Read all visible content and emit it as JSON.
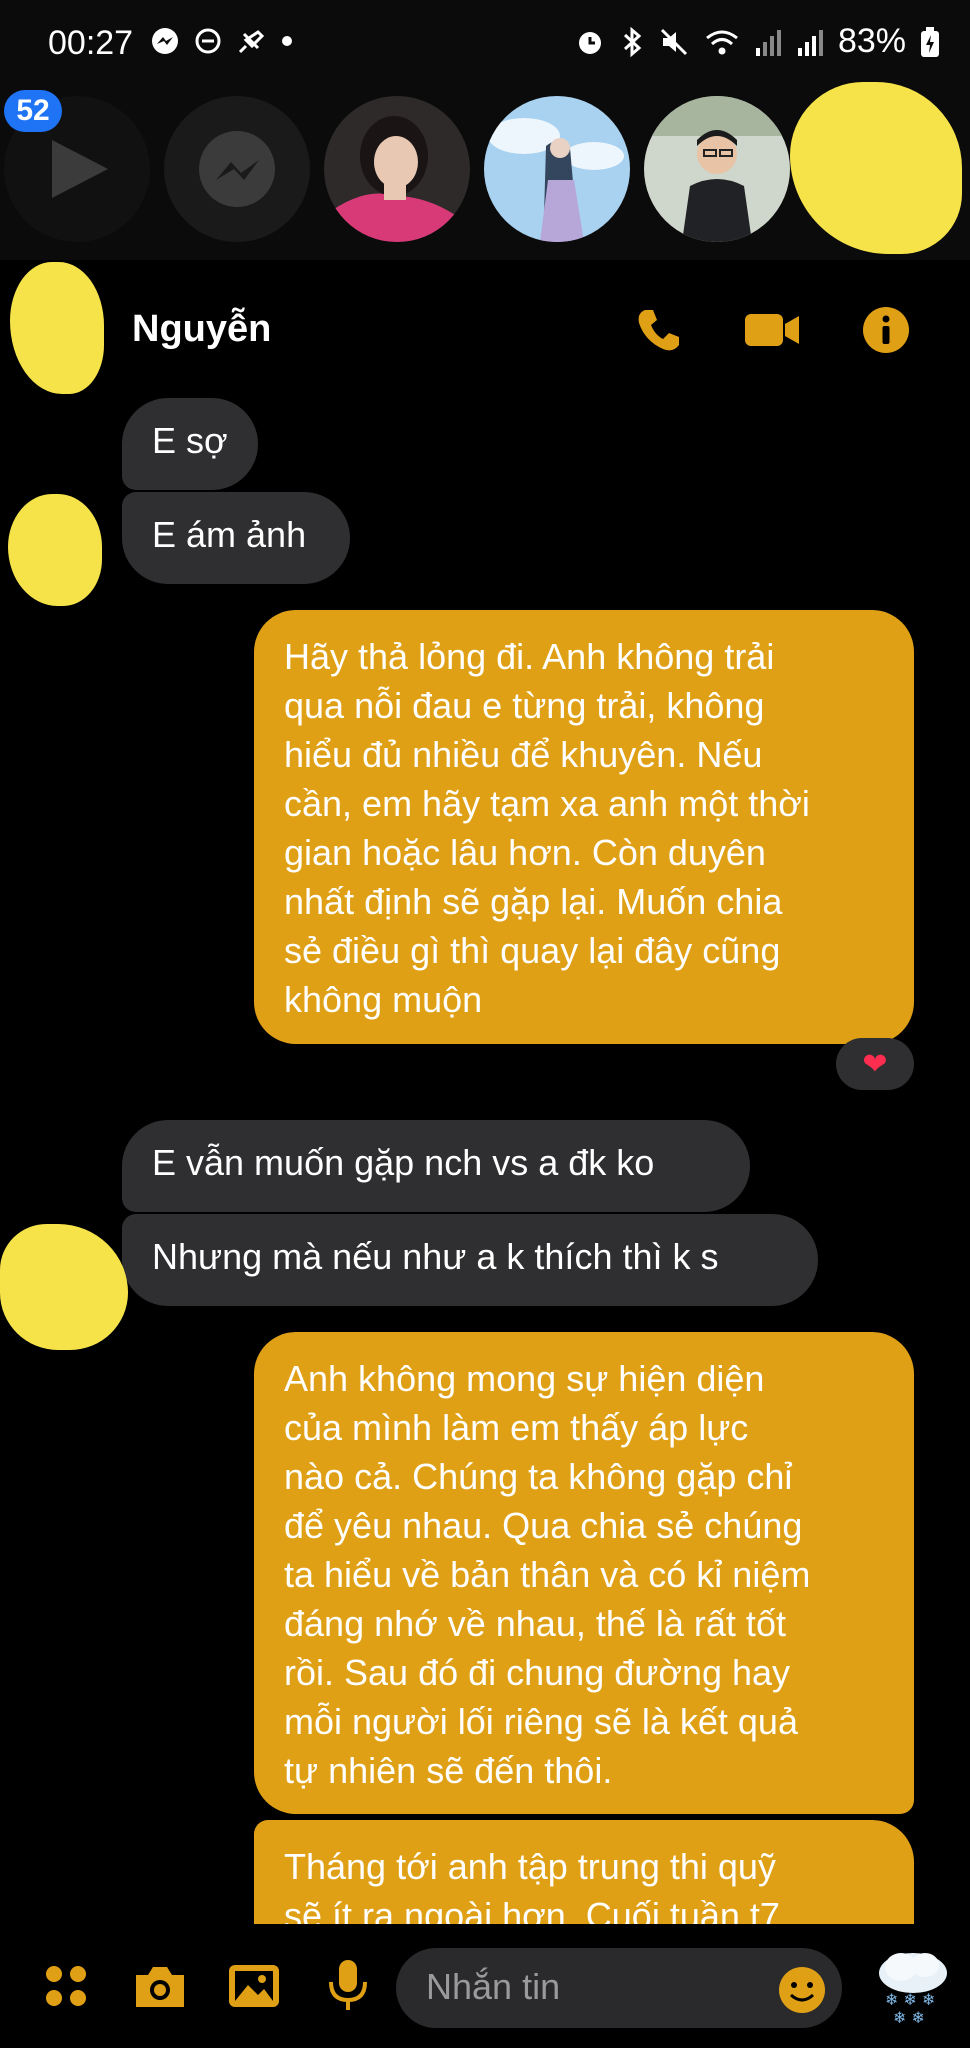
{
  "status_bar": {
    "time": "00:27",
    "battery": "83%",
    "left_icons": [
      "messenger-icon",
      "dnd-icon",
      "pin-off-icon",
      "dot-icon"
    ],
    "right_icons": [
      "alarm-icon",
      "bluetooth-icon",
      "mute-icon",
      "wifi-icon",
      "signal-icon",
      "signal-icon",
      "battery-charging-icon"
    ]
  },
  "stories": {
    "badge_count": "52",
    "items": [
      "play-icon",
      "messenger-icon",
      "avatar-1",
      "avatar-2",
      "avatar-3",
      "avatar-redacted"
    ]
  },
  "chat_header": {
    "contact_name": "Nguyễn",
    "actions": [
      "phone-icon",
      "video-icon",
      "info-icon"
    ]
  },
  "messages": [
    {
      "side": "in",
      "text": "E sợ"
    },
    {
      "side": "in",
      "text": "E ám ảnh"
    },
    {
      "side": "out",
      "text": "Hãy thả lỏng đi. Anh không trải\nqua nỗi đau e từng trải, không\nhiểu đủ nhiều để khuyên. Nếu\ncần, em hãy tạm xa anh một thời\ngian hoặc lâu hơn. Còn duyên\nnhất định sẽ gặp lại. Muốn chia\nsẻ điều gì thì quay lại đây cũng\nkhông muộn",
      "reaction": "❤"
    },
    {
      "side": "in",
      "text": "E vẫn muốn gặp nch vs a đk ko"
    },
    {
      "side": "in",
      "text": "Nhưng mà nếu như a k thích thì k s"
    },
    {
      "side": "out",
      "text": "Anh không mong sự hiện diện\ncủa mình làm em thấy áp lực\nnào cả. Chúng ta không gặp chỉ\nđể yêu nhau. Qua chia sẻ chúng\nta hiểu về bản thân và có kỉ niệm\nđáng nhớ về nhau, thế là rất tốt\nrồi. Sau đó đi chung đường hay\nmỗi người lối riêng sẽ là kết quả\ntự nhiên sẽ đến thôi."
    },
    {
      "side": "out",
      "text": "Tháng tới anh tập trung thi quỹ\nsẽ ít ra ngoài hơn. Cuối tuần t7"
    }
  ],
  "composer": {
    "placeholder": "Nhắn tin",
    "icons": [
      "apps-icon",
      "camera-icon",
      "gallery-icon",
      "mic-icon",
      "emoji-icon",
      "snow-sticker-icon"
    ]
  },
  "colors": {
    "accent": "#e0a015",
    "incoming_bubble": "#2f2f31",
    "background": "#000000",
    "badge": "#1e74f5",
    "redaction": "#f6e34a"
  }
}
